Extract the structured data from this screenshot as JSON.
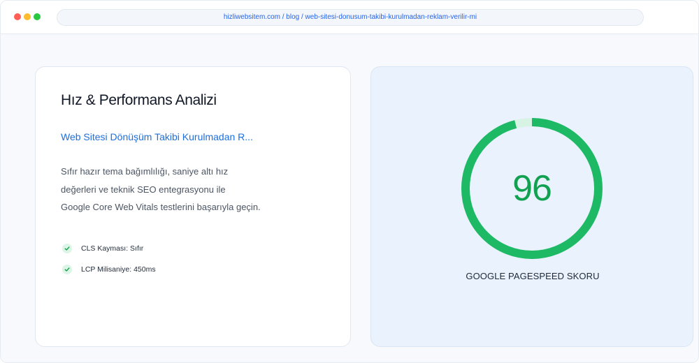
{
  "browser": {
    "url": "hizliwebsitem.com / blog / web-sitesi-donusum-takibi-kurulmadan-reklam-verilir-mi"
  },
  "analysis": {
    "title": "Hız & Performans Analizi",
    "article_link": "Web Sitesi Dönüşüm Takibi Kurulmadan R...",
    "description_lines": [
      "Sıfır hazır tema bağımlılığı, saniye altı hız",
      "değerleri ve teknik SEO entegrasyonu ile",
      "Google Core Web Vitals testlerini başarıyla geçin."
    ],
    "checks": [
      {
        "label": "CLS Kayması: Sıfır",
        "icon": "check-icon"
      },
      {
        "label": "LCP Milisaniye: 450ms",
        "icon": "check-icon"
      }
    ]
  },
  "pagespeed": {
    "score": "96",
    "score_value": 96,
    "label": "GOOGLE PAGESPEED SKORU",
    "colors": {
      "ring": "#1db965",
      "track": "#d7f3e3",
      "score_text": "#12a150"
    }
  }
}
